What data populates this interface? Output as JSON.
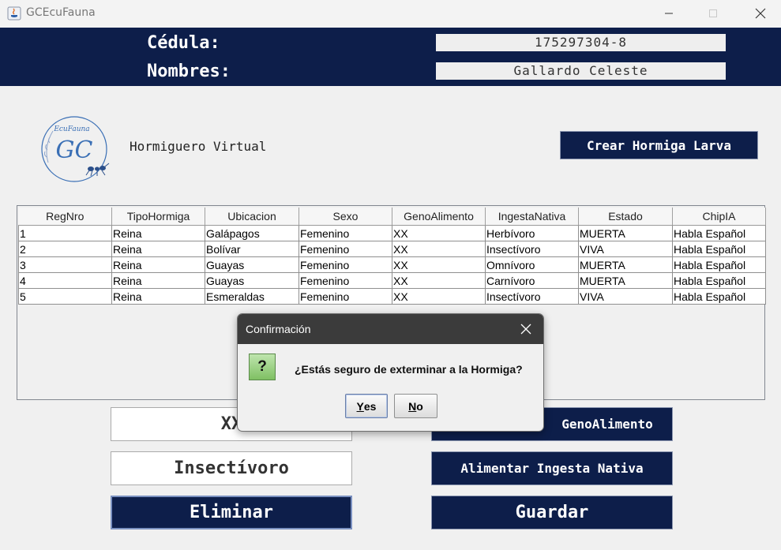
{
  "window": {
    "title": "GCEcuFauna"
  },
  "header": {
    "cedula_label": "Cédula:",
    "cedula_value": "175297304-8",
    "nombres_label": "Nombres:",
    "nombres_value": "Gallardo Celeste"
  },
  "logo": {
    "text_top": "EcuFauna",
    "text_main": "GC"
  },
  "main": {
    "hormiguero_label": "Hormiguero Virtual",
    "crear_button": "Crear Hormiga Larva"
  },
  "table": {
    "columns": [
      "RegNro",
      "TipoHormiga",
      "Ubicacion",
      "Sexo",
      "GenoAlimento",
      "IngestaNativa",
      "Estado",
      "ChipIA"
    ],
    "rows": [
      [
        "1",
        "Reina",
        "Galápagos",
        "Femenino",
        "XX",
        "Herbívoro",
        "MUERTA",
        "Habla Español"
      ],
      [
        "2",
        "Reina",
        "Bolívar",
        "Femenino",
        "XX",
        "Insectívoro",
        "VIVA",
        "Habla Español"
      ],
      [
        "3",
        "Reina",
        "Guayas",
        "Femenino",
        "XX",
        "Omnívoro",
        "MUERTA",
        "Habla Español"
      ],
      [
        "4",
        "Reina",
        "Guayas",
        "Femenino",
        "XX",
        "Carnívoro",
        "MUERTA",
        "Habla Español"
      ],
      [
        "5",
        "Reina",
        "Esmeraldas",
        "Femenino",
        "XX",
        "Insectívoro",
        "VIVA",
        "Habla Español"
      ]
    ]
  },
  "buttons": {
    "xx": "XX",
    "insectivoro": "Insectívoro",
    "eliminar": "Eliminar",
    "geno": "GenoAlimento",
    "alimentar": "Alimentar Ingesta Nativa",
    "guardar": "Guardar"
  },
  "dialog": {
    "title": "Confirmación",
    "icon_glyph": "?",
    "message": "¿Estás seguro de exterminar a la Hormiga?",
    "yes_mnemonic": "Y",
    "yes_rest": "es",
    "no_mnemonic": "N",
    "no_rest": "o"
  },
  "colors": {
    "navy": "#0d1e4a",
    "logo_blue": "#3a6fb5",
    "dialog_title": "#3b3b3b"
  }
}
